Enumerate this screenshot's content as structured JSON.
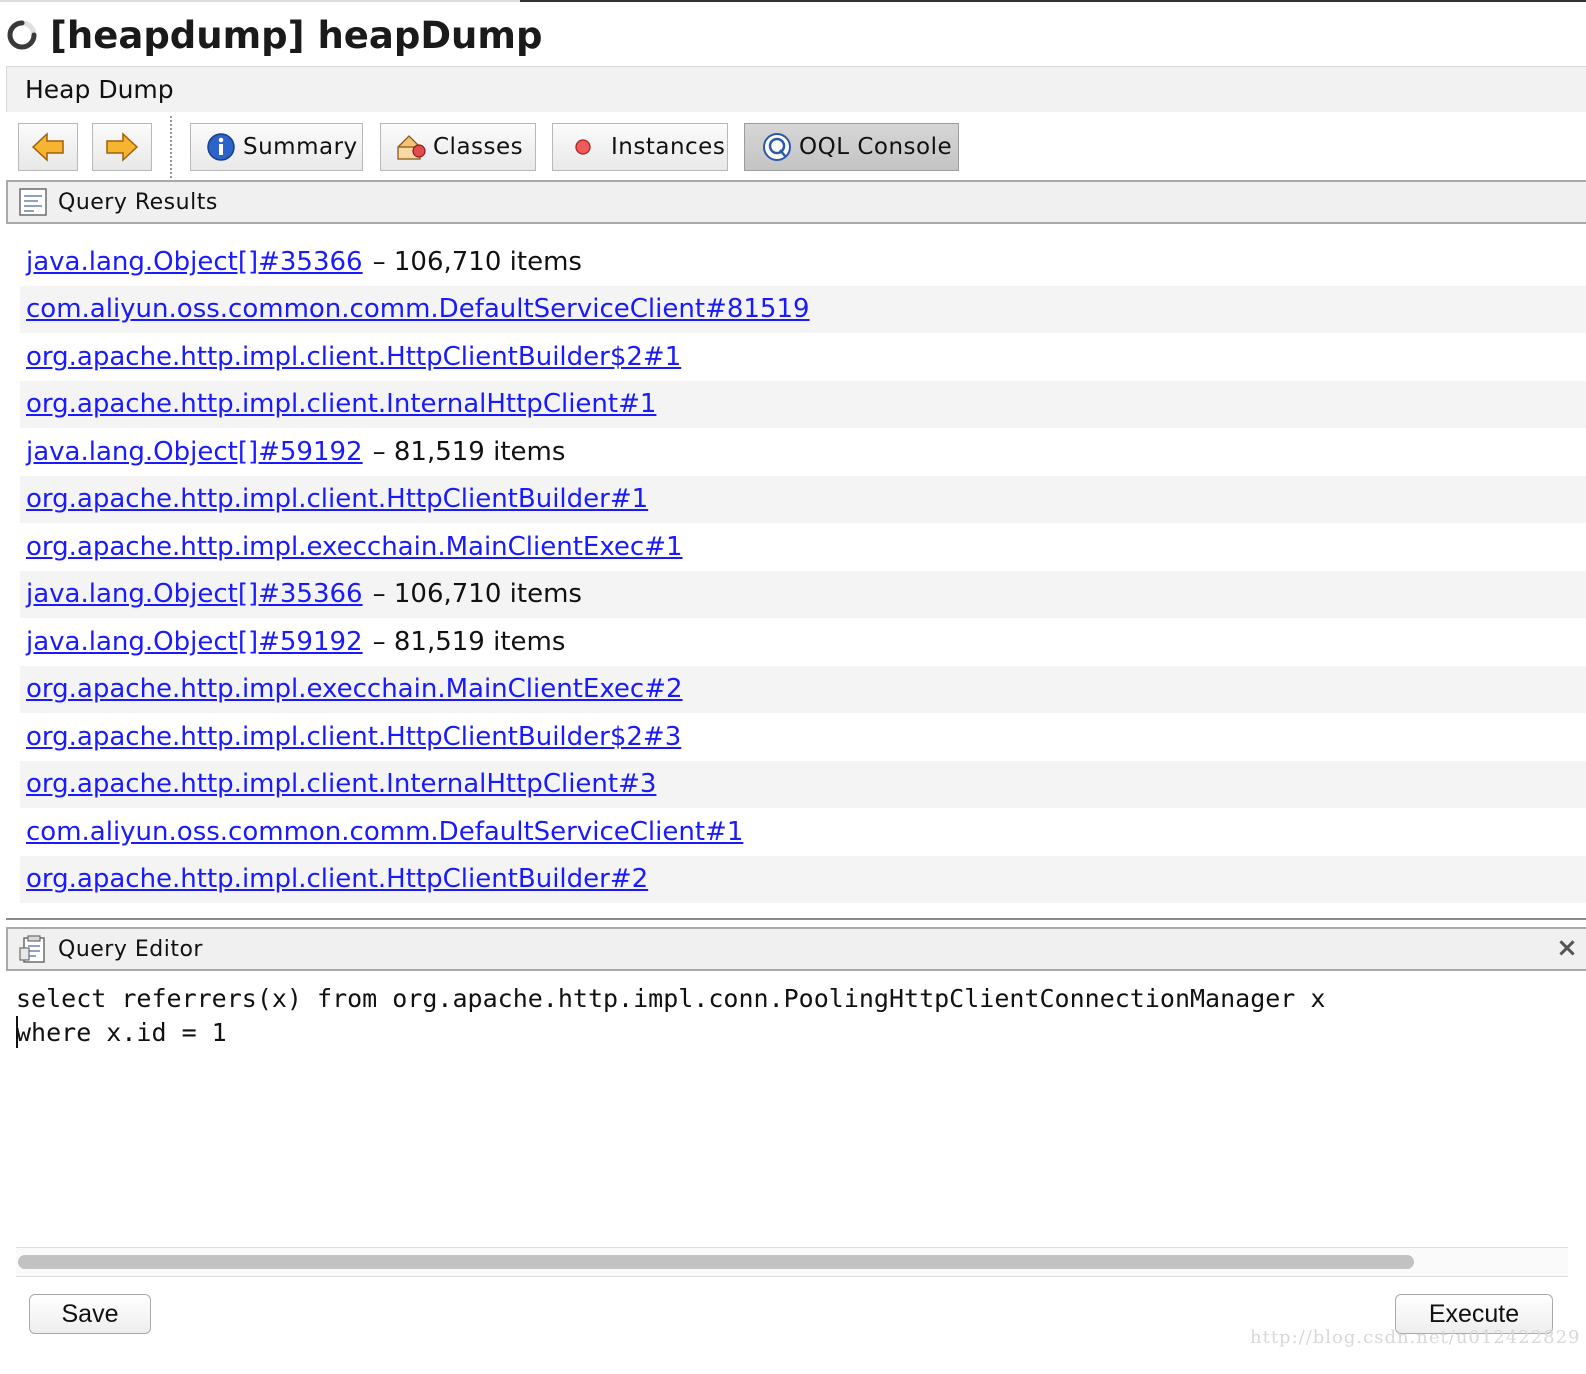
{
  "window": {
    "title": "[heapdump] heapDump"
  },
  "tab": {
    "label": "Heap Dump"
  },
  "toolbar": {
    "back_icon": "arrow-left-icon",
    "forward_icon": "arrow-right-icon",
    "buttons": [
      {
        "label": "Summary",
        "icon": "info-icon",
        "active": false
      },
      {
        "label": "Classes",
        "icon": "classes-icon",
        "active": false
      },
      {
        "label": "Instances",
        "icon": "instance-dot-icon",
        "active": false
      },
      {
        "label": "OQL Console",
        "icon": "oql-icon",
        "active": true
      }
    ]
  },
  "results": {
    "header": "Query Results",
    "rows": [
      {
        "link": "java.lang.Object[]#35366",
        "suffix": "– 106,710 items"
      },
      {
        "link": "com.aliyun.oss.common.comm.DefaultServiceClient#81519",
        "suffix": ""
      },
      {
        "link": "org.apache.http.impl.client.HttpClientBuilder$2#1",
        "suffix": ""
      },
      {
        "link": "org.apache.http.impl.client.InternalHttpClient#1",
        "suffix": ""
      },
      {
        "link": "java.lang.Object[]#59192",
        "suffix": "– 81,519 items"
      },
      {
        "link": "org.apache.http.impl.client.HttpClientBuilder#1",
        "suffix": ""
      },
      {
        "link": "org.apache.http.impl.execchain.MainClientExec#1",
        "suffix": ""
      },
      {
        "link": "java.lang.Object[]#35366",
        "suffix": "– 106,710 items"
      },
      {
        "link": "java.lang.Object[]#59192",
        "suffix": "– 81,519 items"
      },
      {
        "link": "org.apache.http.impl.execchain.MainClientExec#2",
        "suffix": ""
      },
      {
        "link": "org.apache.http.impl.client.HttpClientBuilder$2#3",
        "suffix": ""
      },
      {
        "link": "org.apache.http.impl.client.InternalHttpClient#3",
        "suffix": ""
      },
      {
        "link": "com.aliyun.oss.common.comm.DefaultServiceClient#1",
        "suffix": ""
      },
      {
        "link": "org.apache.http.impl.client.HttpClientBuilder#2",
        "suffix": ""
      }
    ]
  },
  "editor": {
    "header": "Query Editor",
    "query": "select referrers(x) from org.apache.http.impl.conn.PoolingHttpClientConnectionManager x\nwhere x.id = 1"
  },
  "actions": {
    "save_label": "Save",
    "execute_label": "Execute"
  },
  "watermark": "http://blog.csdn.net/u012422829",
  "colors": {
    "link": "#1a1aff",
    "active_button": "#c8c8c8",
    "row_alt": "#f4f4f4"
  }
}
